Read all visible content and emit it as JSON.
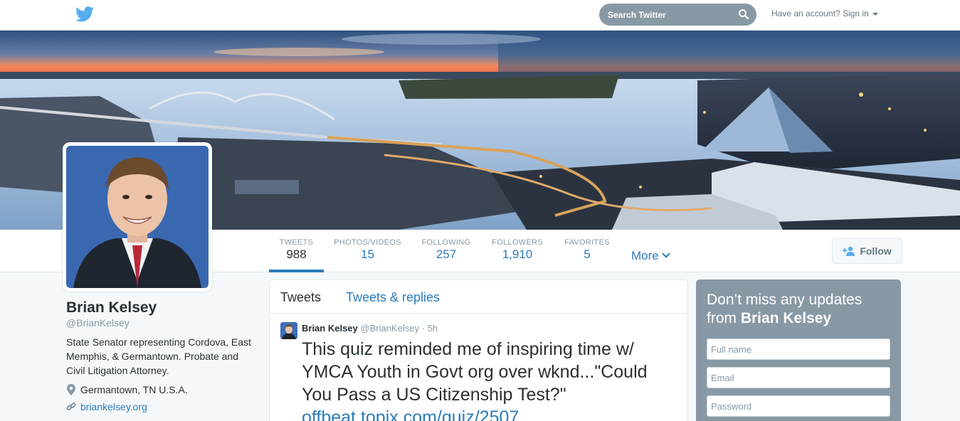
{
  "topbar": {
    "logo_icon": "twitter-bird-icon",
    "search_placeholder": "Search Twitter",
    "search_icon": "search-icon",
    "signin_label": "Have an account? Sign in",
    "signin_caret": "caret-down-icon"
  },
  "profile": {
    "name": "Brian Kelsey",
    "handle": "@BrianKelsey",
    "bio": "State Senator representing Cordova, East Memphis, & Germantown. Probate and Civil Litigation Attorney.",
    "location": "Germantown, TN U.S.A.",
    "location_icon": "location-pin-icon",
    "website": "briankelsey.org",
    "website_icon": "link-icon"
  },
  "stats": [
    {
      "label": "TWEETS",
      "value": "988"
    },
    {
      "label": "PHOTOS/VIDEOS",
      "value": "15"
    },
    {
      "label": "FOLLOWING",
      "value": "257"
    },
    {
      "label": "FOLLOWERS",
      "value": "1,910"
    },
    {
      "label": "FAVORITES",
      "value": "5"
    }
  ],
  "nav": {
    "more_label": "More",
    "follow_label": "Follow",
    "follow_icon": "add-user-icon"
  },
  "timeline": {
    "tabs": [
      "Tweets",
      "Tweets & replies"
    ],
    "tweet": {
      "name": "Brian Kelsey",
      "handle": "@BrianKelsey",
      "separator": "·",
      "time": "5h",
      "text": "This quiz reminded me of inspiring time w/ YMCA Youth in Govt org over wknd...\"Could You Pass a US Citizenship Test?\"",
      "link": "offbeat.topix.com/quiz/2507"
    }
  },
  "signup": {
    "title_prefix": "Don’t miss any updates from",
    "title_name": "Brian Kelsey",
    "fullname_placeholder": "Full name",
    "email_placeholder": "Email",
    "password_placeholder": "Password"
  },
  "colors": {
    "accent": "#2b7bb9",
    "muted": "#8899a6",
    "signup_bg": "#8899a6",
    "twitter_blue": "#55acee"
  }
}
